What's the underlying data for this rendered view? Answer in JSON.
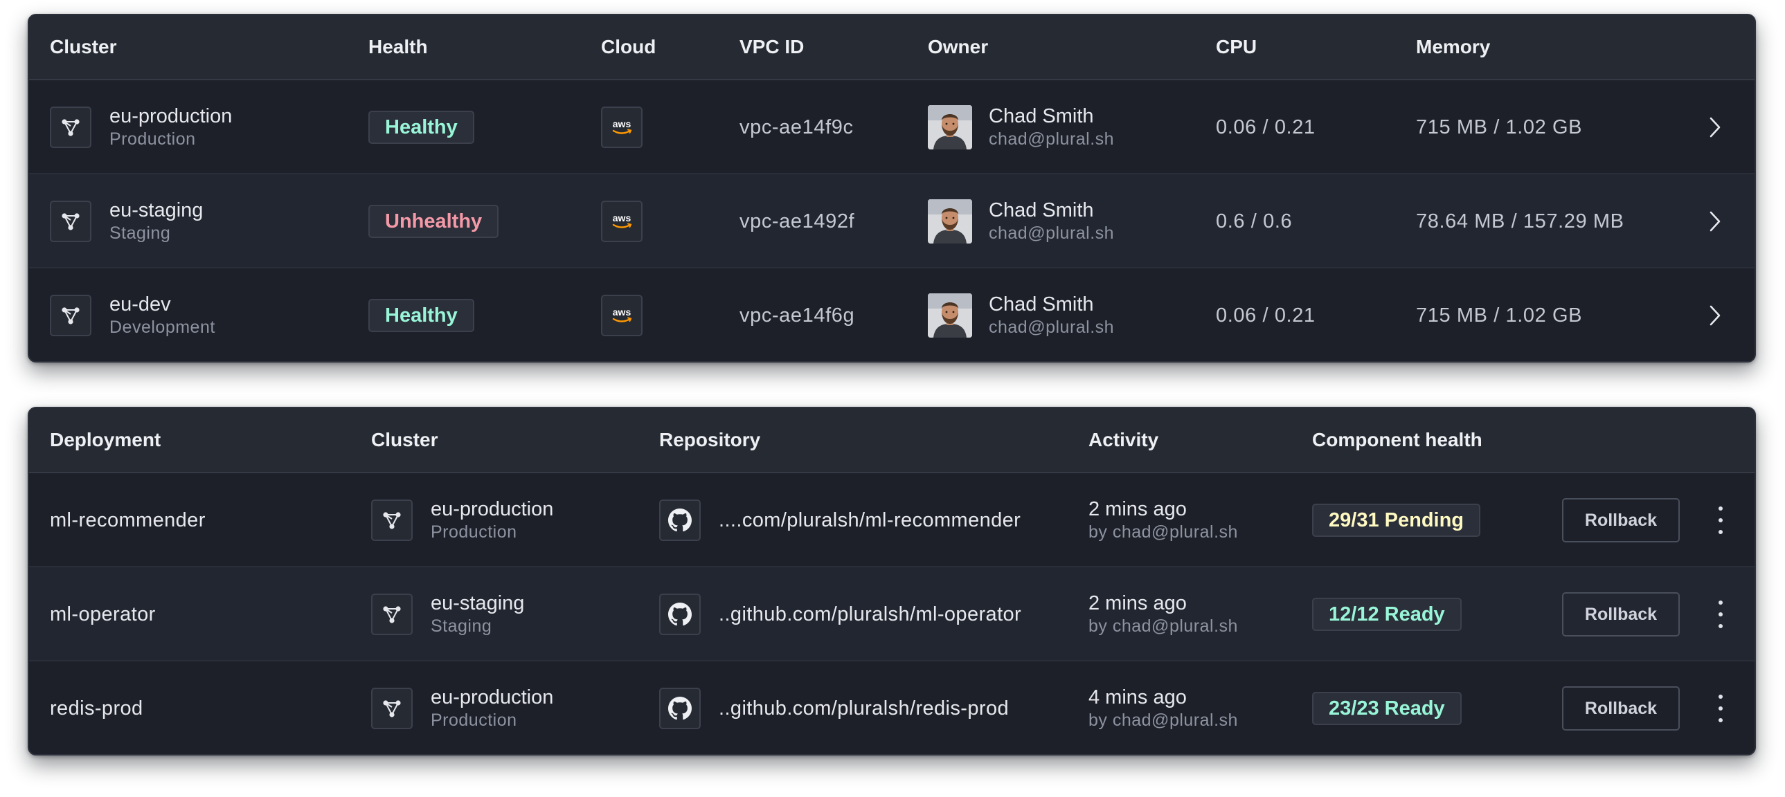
{
  "clusters_table": {
    "headers": [
      "Cluster",
      "Health",
      "Cloud",
      "VPC ID",
      "Owner",
      "CPU",
      "Memory"
    ],
    "rows": [
      {
        "name": "eu-production",
        "env": "Production",
        "health": "Healthy",
        "health_status": "good",
        "cloud": "aws",
        "vpc": "vpc-ae14f9c",
        "owner_name": "Chad Smith",
        "owner_email": "chad@plural.sh",
        "cpu": "0.06 / 0.21",
        "memory": "715 MB / 1.02 GB"
      },
      {
        "name": "eu-staging",
        "env": "Staging",
        "health": "Unhealthy",
        "health_status": "bad",
        "cloud": "aws",
        "vpc": "vpc-ae1492f",
        "owner_name": "Chad Smith",
        "owner_email": "chad@plural.sh",
        "cpu": "0.6 / 0.6",
        "memory": "78.64  MB /  157.29 MB"
      },
      {
        "name": "eu-dev",
        "env": "Development",
        "health": "Healthy",
        "health_status": "good",
        "cloud": "aws",
        "vpc": "vpc-ae14f6g",
        "owner_name": "Chad Smith",
        "owner_email": "chad@plural.sh",
        "cpu": "0.06 / 0.21",
        "memory": "715 MB / 1.02 GB"
      }
    ]
  },
  "deployments_table": {
    "headers": [
      "Deployment",
      "Cluster",
      "Repository",
      "Activity",
      "Component health"
    ],
    "rows": [
      {
        "name": "ml-recommender",
        "cluster": "eu-production",
        "cluster_env": "Production",
        "repo": "....com/pluralsh/ml-recommender",
        "activity_time": "2 mins ago",
        "activity_by": "by chad@plural.sh",
        "component_health": "29/31 Pending",
        "health_status": "warn",
        "action": "Rollback"
      },
      {
        "name": "ml-operator",
        "cluster": "eu-staging",
        "cluster_env": "Staging",
        "repo": "..github.com/pluralsh/ml-operator",
        "activity_time": "2 mins ago",
        "activity_by": "by chad@plural.sh",
        "component_health": "12/12 Ready",
        "health_status": "good",
        "action": "Rollback"
      },
      {
        "name": "redis-prod",
        "cluster": "eu-production",
        "cluster_env": "Production",
        "repo": "..github.com/pluralsh/redis-prod",
        "activity_time": "4 mins ago",
        "activity_by": "by chad@plural.sh",
        "component_health": "23/23 Ready",
        "health_status": "good",
        "action": "Rollback"
      }
    ]
  },
  "icons": {
    "cluster": "cluster-icon",
    "cloud": "aws-logo-icon",
    "repository": "github-icon",
    "row_open": "chevron-right-icon",
    "row_menu": "more-vertical-icon"
  },
  "colors": {
    "background": "#1d2028",
    "header_background": "#262a33",
    "healthy": "#99f5d7",
    "unhealthy": "#f599a8",
    "pending": "#fff9c2",
    "aws_orange": "#ff9900"
  }
}
